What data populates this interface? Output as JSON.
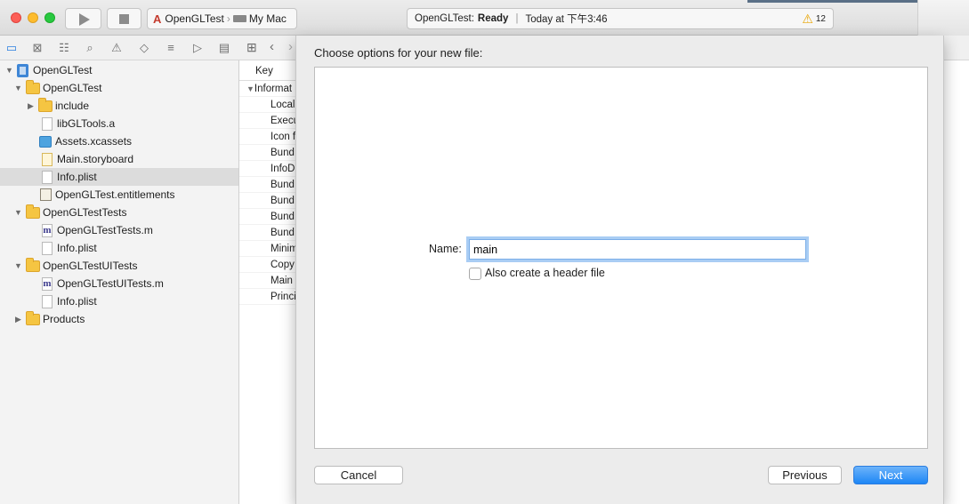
{
  "toolbar": {
    "scheme_target": "OpenGLTest",
    "scheme_device": "My Mac",
    "status_project": "OpenGLTest:",
    "status_state": "Ready",
    "status_time": "Today at 下午3:46",
    "warning_count": "12"
  },
  "navigator": {
    "items": [
      {
        "label": "OpenGLTest",
        "icon": "project-icon",
        "indent": 0,
        "disclosure": "expanded"
      },
      {
        "label": "OpenGLTest",
        "icon": "folder-icon",
        "indent": 1,
        "disclosure": "expanded"
      },
      {
        "label": "include",
        "icon": "folder-icon",
        "indent": 2,
        "disclosure": "collapsed"
      },
      {
        "label": "libGLTools.a",
        "icon": "file-icon",
        "indent": 2
      },
      {
        "label": "Assets.xcassets",
        "icon": "asset-catalog-icon",
        "indent": 2
      },
      {
        "label": "Main.storyboard",
        "icon": "storyboard-icon",
        "indent": 2
      },
      {
        "label": "Info.plist",
        "icon": "file-icon",
        "indent": 2,
        "selected": true
      },
      {
        "label": "OpenGLTest.entitlements",
        "icon": "entitlements-icon",
        "indent": 2
      },
      {
        "label": "OpenGLTestTests",
        "icon": "folder-icon",
        "indent": 1,
        "disclosure": "expanded"
      },
      {
        "label": "OpenGLTestTests.m",
        "icon": "objc-file-icon",
        "indent": 2
      },
      {
        "label": "Info.plist",
        "icon": "file-icon",
        "indent": 2
      },
      {
        "label": "OpenGLTestUITests",
        "icon": "folder-icon",
        "indent": 1,
        "disclosure": "expanded"
      },
      {
        "label": "OpenGLTestUITests.m",
        "icon": "objc-file-icon",
        "indent": 2
      },
      {
        "label": "Info.plist",
        "icon": "file-icon",
        "indent": 2
      },
      {
        "label": "Products",
        "icon": "folder-icon",
        "indent": 1,
        "disclosure": "collapsed"
      }
    ]
  },
  "plist": {
    "key_header": "Key",
    "rows": [
      "Informat",
      "Local",
      "Execu",
      "Icon f",
      "Bund",
      "InfoD",
      "Bund",
      "Bund",
      "Bund",
      "Bund",
      "Minim",
      "Copy",
      "Main",
      "Princi"
    ]
  },
  "sheet": {
    "title": "Choose options for your new file:",
    "name_label": "Name:",
    "name_value": "main",
    "header_checkbox_label": "Also create a header file",
    "header_checkbox_checked": false,
    "cancel_label": "Cancel",
    "previous_label": "Previous",
    "next_label": "Next"
  },
  "colors": {
    "accent": "#1e86f5",
    "selection": "#dcdcdc",
    "warning": "#e8a400",
    "folder": "#f5c542"
  }
}
